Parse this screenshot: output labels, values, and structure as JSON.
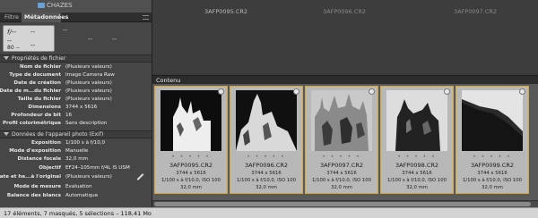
{
  "folder": {
    "name": "CHAZES"
  },
  "tabs": {
    "filter": "Filtre",
    "metadata": "Métadonnées"
  },
  "exif_box": {
    "aperture": "f/--",
    "dash_a": "--",
    "dash_b": "--",
    "iso": "--",
    "wb": "80 --",
    "dash_c": "--",
    "dash_d": "--",
    "dash_e": "--"
  },
  "file_props": {
    "header": "Propriétés de fichier",
    "rows": [
      {
        "key": "Nom de fichier",
        "value": "(Plusieurs valeurs)"
      },
      {
        "key": "Type de document",
        "value": "Image Camera Raw"
      },
      {
        "key": "Date de création",
        "value": "(Plusieurs valeurs)"
      },
      {
        "key": "Date de m...du fichier",
        "value": "(Plusieurs valeurs)"
      },
      {
        "key": "Taille du fichier",
        "value": "(Plusieurs valeurs)"
      },
      {
        "key": "Dimensions",
        "value": "3744 x 5616"
      },
      {
        "key": "Profondeur de bit",
        "value": "16"
      },
      {
        "key": "Profil colorimétrique",
        "value": "Sans description"
      }
    ]
  },
  "camera_data": {
    "header": "Données de l'appareil photo (Exif)",
    "rows": [
      {
        "key": "Exposition",
        "value": "1/100 s à f/10,0"
      },
      {
        "key": "Mode d'exposition",
        "value": "Manuelle"
      },
      {
        "key": "Distance focale",
        "value": "32,0 mm"
      },
      {
        "key": "Objectif",
        "value": "EF24–105mm f/4L IS USM"
      },
      {
        "key": "Date et he...à l'original",
        "value": "(Plusieurs valeurs)"
      },
      {
        "key": "Mode de mesure",
        "value": "Evaluation"
      },
      {
        "key": "Balance des blancs",
        "value": "Automatique"
      }
    ]
  },
  "top_labels": [
    "3AFP0095.CR2",
    "3AFP0096.CR2",
    "3AFP0097.CR2"
  ],
  "content": {
    "title": "Contenu",
    "cards": [
      {
        "filename": "3AFP0095.CR2",
        "dims": "3744 x 5616",
        "exposure": "1/100 s à f/10,0, ISO 100",
        "focal": "32,0 mm"
      },
      {
        "filename": "3AFP0096.CR2",
        "dims": "3744 x 5616",
        "exposure": "1/100 s à f/10,0, ISO 100",
        "focal": "32,0 mm"
      },
      {
        "filename": "3AFP0097.CR2",
        "dims": "3744 x 5616",
        "exposure": "1/100 s à f/10,0, ISO 100",
        "focal": "32,0 mm"
      },
      {
        "filename": "3AFP0098.CR2",
        "dims": "3744 x 5616",
        "exposure": "1/100 s à f/10,0, ISO 100",
        "focal": "32,0 mm"
      },
      {
        "filename": "3AFP0099.CR2",
        "dims": "3744 x 5616",
        "exposure": "1/100 s à f/10,0, ISO 100",
        "focal": "32,0 mm"
      }
    ],
    "rating_dots": "• • • • •"
  },
  "status": {
    "text": "17 éléments, 7 masqués, 5 sélections – 118,41 Mo"
  },
  "colors": {
    "accent": "#d6a638",
    "panel": "#464646",
    "content_bg": "#595959"
  }
}
